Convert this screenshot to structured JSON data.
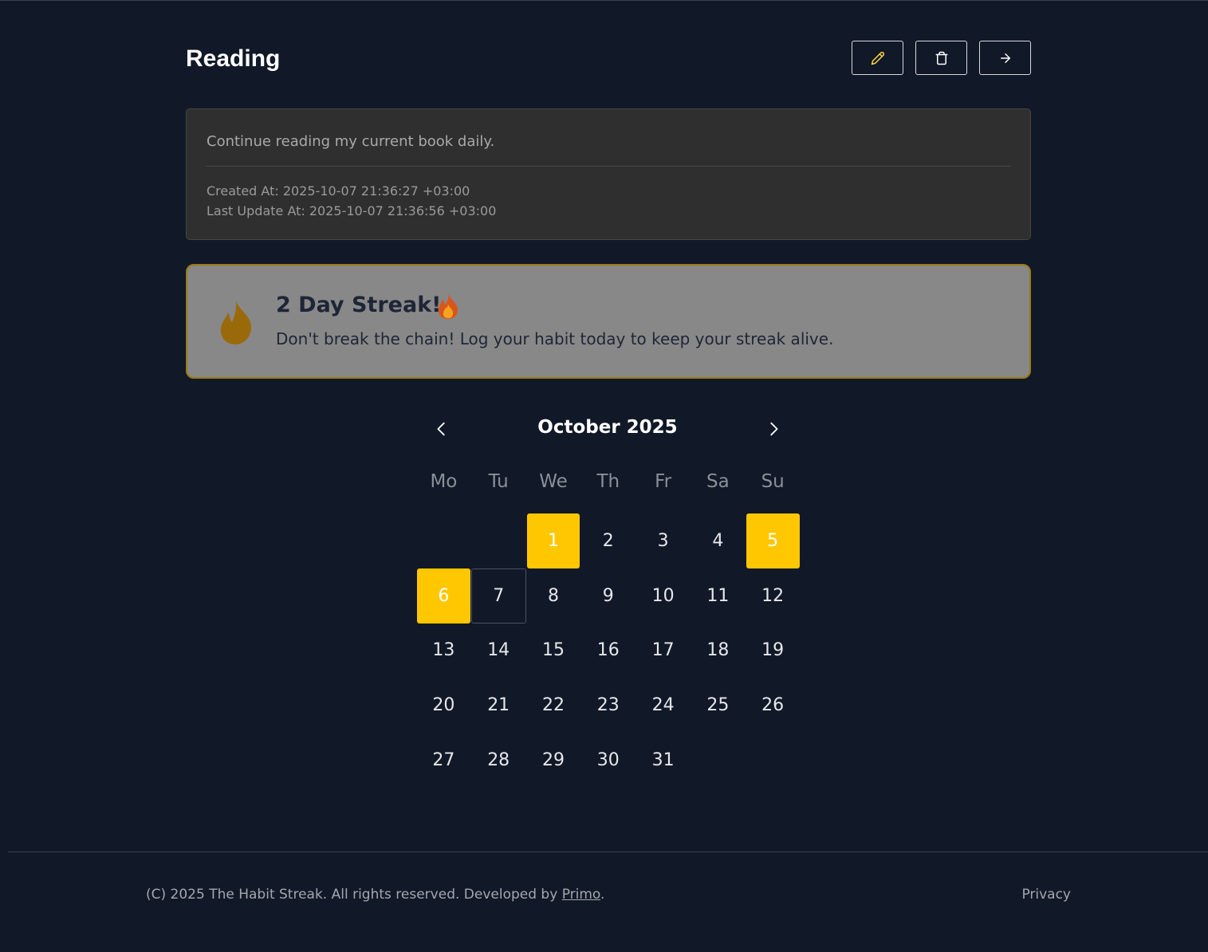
{
  "habit": {
    "title": "Reading",
    "description": "Continue reading my current book daily.",
    "created_at": "Created At: 2025-10-07 21:36:27 +03:00",
    "updated_at": "Last Update At: 2025-10-07 21:36:56 +03:00"
  },
  "actions": {
    "edit_icon": "pencil-icon",
    "delete_icon": "trash-icon",
    "go_icon": "arrow-right-icon"
  },
  "streak": {
    "title": "2 Day Streak!",
    "message": "Don't break the chain! Log your habit today to keep your streak alive.",
    "accent": "#9a7a10"
  },
  "calendar": {
    "month_label": "October 2025",
    "weekdays": [
      "Mo",
      "Tu",
      "We",
      "Th",
      "Fr",
      "Sa",
      "Su"
    ],
    "leading_blanks": 2,
    "days_in_month": 31,
    "completed_days": [
      1,
      5,
      6
    ],
    "today": 7,
    "completed_color": "#ffc700"
  },
  "footer": {
    "copyright_prefix": "(C) 2025 The Habit Streak. All rights reserved. Developed by",
    "author_link": "Primo",
    "period": ".",
    "privacy": "Privacy"
  }
}
